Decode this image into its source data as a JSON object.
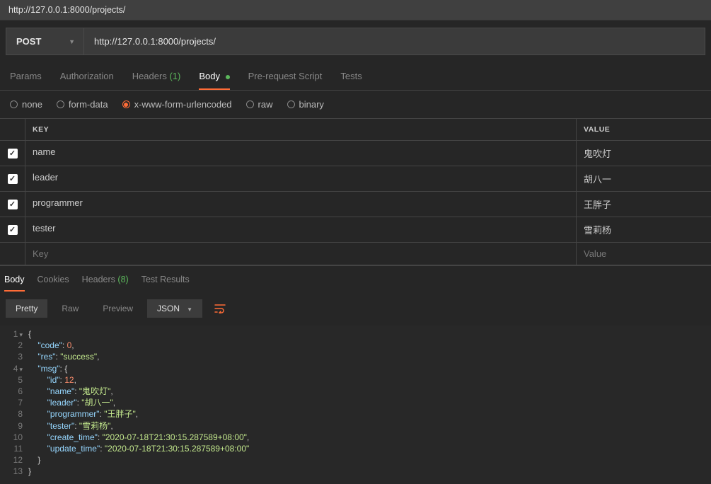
{
  "url_bar": "http://127.0.0.1:8000/projects/",
  "request": {
    "method": "POST",
    "url": "http://127.0.0.1:8000/projects/"
  },
  "request_tabs": {
    "params": "Params",
    "auth": "Authorization",
    "headers_label": "Headers",
    "headers_count": "(1)",
    "body": "Body",
    "prereq": "Pre-request Script",
    "tests": "Tests"
  },
  "body_type_options": {
    "none": "none",
    "form_data": "form-data",
    "xform": "x-www-form-urlencoded",
    "raw": "raw",
    "binary": "binary"
  },
  "kv_header": {
    "key": "KEY",
    "value": "VALUE"
  },
  "kv_rows": [
    {
      "key": "name",
      "value": "鬼吹灯"
    },
    {
      "key": "leader",
      "value": "胡八一"
    },
    {
      "key": "programmer",
      "value": "王胖子"
    },
    {
      "key": "tester",
      "value": "雪莉杨"
    }
  ],
  "kv_placeholder": {
    "key": "Key",
    "value": "Value"
  },
  "response_tabs": {
    "body": "Body",
    "cookies": "Cookies",
    "headers_label": "Headers",
    "headers_count": "(8)",
    "tests": "Test Results"
  },
  "resp_toolbar": {
    "pretty": "Pretty",
    "raw": "Raw",
    "preview": "Preview",
    "format": "JSON"
  },
  "response_json": {
    "code": 0,
    "res": "success",
    "msg": {
      "id": 12,
      "name": "鬼吹灯",
      "leader": "胡八一",
      "programmer": "王胖子",
      "tester": "雪莉杨",
      "create_time": "2020-07-18T21:30:15.287589+08:00",
      "update_time": "2020-07-18T21:30:15.287589+08:00"
    }
  }
}
